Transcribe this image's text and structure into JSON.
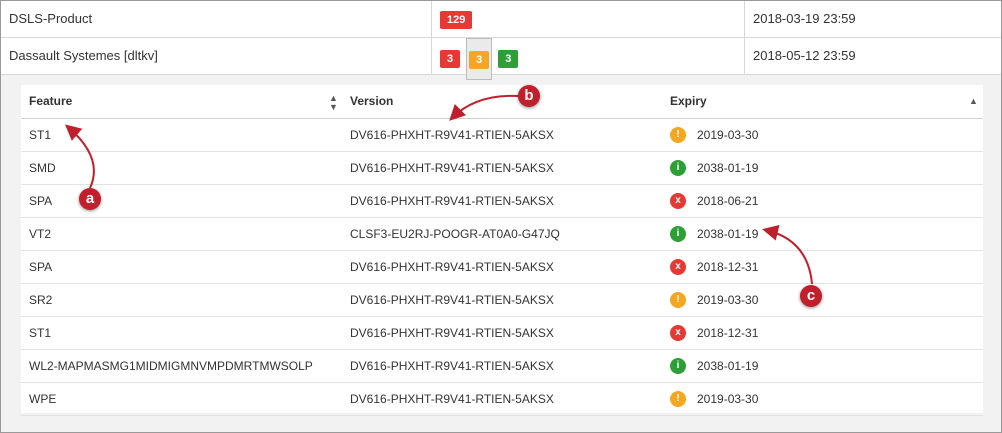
{
  "products": [
    {
      "name": "DSLS-Product",
      "badges": [
        {
          "value": "129",
          "color": "#e53935"
        }
      ],
      "date": "2018-03-19 23:59"
    },
    {
      "name": "Dassault Systemes [dltkv]",
      "badges": [
        {
          "value": "3",
          "color": "#e53935"
        },
        {
          "value": "3",
          "color": "#f5a623"
        },
        {
          "value": "3",
          "color": "#2e9e37"
        }
      ],
      "date": "2018-05-12 23:59"
    }
  ],
  "table": {
    "headers": {
      "feature": "Feature",
      "version": "Version",
      "expiry": "Expiry"
    },
    "rows": [
      {
        "feature": "ST1",
        "version": "DV616-PHXHT-R9V41-RTIEN-5AKSX",
        "status": "warning",
        "expiry": "2019-03-30"
      },
      {
        "feature": "SMD",
        "version": "DV616-PHXHT-R9V41-RTIEN-5AKSX",
        "status": "ok",
        "expiry": "2038-01-19"
      },
      {
        "feature": "SPA",
        "version": "DV616-PHXHT-R9V41-RTIEN-5AKSX",
        "status": "error",
        "expiry": "2018-06-21"
      },
      {
        "feature": "VT2",
        "version": "CLSF3-EU2RJ-POOGR-AT0A0-G47JQ",
        "status": "ok",
        "expiry": "2038-01-19"
      },
      {
        "feature": "SPA",
        "version": "DV616-PHXHT-R9V41-RTIEN-5AKSX",
        "status": "error",
        "expiry": "2018-12-31"
      },
      {
        "feature": "SR2",
        "version": "DV616-PHXHT-R9V41-RTIEN-5AKSX",
        "status": "warning",
        "expiry": "2019-03-30"
      },
      {
        "feature": "ST1",
        "version": "DV616-PHXHT-R9V41-RTIEN-5AKSX",
        "status": "error",
        "expiry": "2018-12-31"
      },
      {
        "feature": "WL2-MAPMASMG1MIDMIGMNVMPDMRTMWSOLP",
        "version": "DV616-PHXHT-R9V41-RTIEN-5AKSX",
        "status": "ok",
        "expiry": "2038-01-19"
      },
      {
        "feature": "WPE",
        "version": "DV616-PHXHT-R9V41-RTIEN-5AKSX",
        "status": "warning",
        "expiry": "2019-03-30"
      }
    ]
  },
  "status_icons": {
    "warning": {
      "glyph": "!",
      "icon": "warning-icon",
      "color": "#f5a623"
    },
    "ok": {
      "glyph": "i",
      "icon": "ok-icon",
      "color": "#2e9e37"
    },
    "error": {
      "glyph": "x",
      "icon": "error-icon",
      "color": "#e53935"
    }
  },
  "annotations": [
    {
      "label": "a",
      "target": "feature column"
    },
    {
      "label": "b",
      "target": "version column"
    },
    {
      "label": "c",
      "target": "expiry column"
    }
  ],
  "colors": {
    "marker": "#c0202c"
  }
}
